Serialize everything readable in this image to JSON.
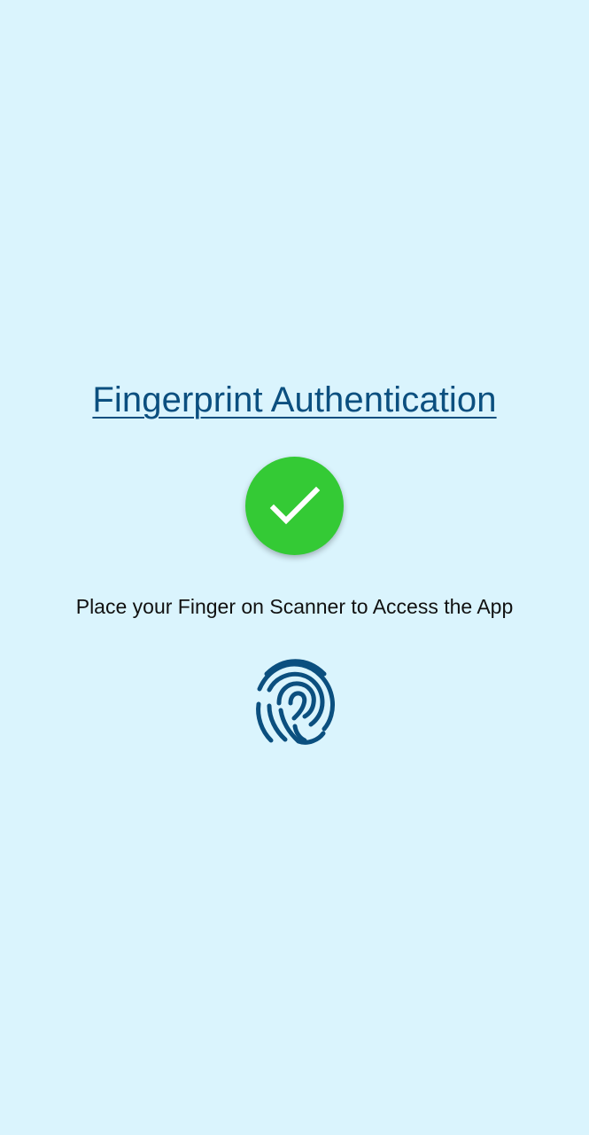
{
  "screen": {
    "title": "Fingerprint Authentication",
    "instruction": "Place your Finger on Scanner to Access the App",
    "status_icon": "checkmark-icon",
    "scanner_icon": "fingerprint-icon"
  },
  "colors": {
    "background": "#daf4fd",
    "title": "#0b4f7f",
    "success": "#34ca35",
    "fingerprint": "#0b4f7f",
    "text": "#111111"
  }
}
